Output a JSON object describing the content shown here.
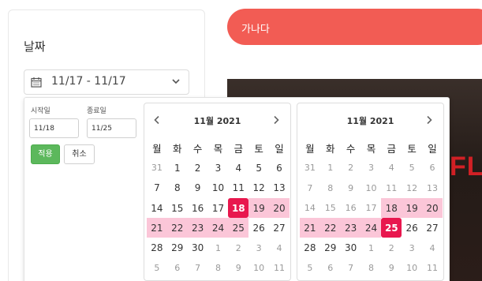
{
  "filter": {
    "title": "날짜",
    "range_text": "11/17 - 11/17"
  },
  "banner": {
    "text": "가나다",
    "color": "#f25c54"
  },
  "background": {
    "brand_text": "FLIX"
  },
  "picker": {
    "start_label": "시작일",
    "end_label": "종료일",
    "start_value": "11/18",
    "end_value": "11/25",
    "apply_label": "적용",
    "cancel_label": "취소",
    "accent": "#e8174e",
    "range_color": "#fbc6d8",
    "calendars": [
      {
        "title": "11월 2021",
        "endpoint_day": "18",
        "weekdays": [
          "월",
          "화",
          "수",
          "목",
          "금",
          "토",
          "일"
        ],
        "weeks": [
          [
            {
              "d": "31",
              "s": "off"
            },
            {
              "d": "1",
              "s": ""
            },
            {
              "d": "2",
              "s": ""
            },
            {
              "d": "3",
              "s": ""
            },
            {
              "d": "4",
              "s": ""
            },
            {
              "d": "5",
              "s": ""
            },
            {
              "d": "6",
              "s": ""
            }
          ],
          [
            {
              "d": "7",
              "s": ""
            },
            {
              "d": "8",
              "s": ""
            },
            {
              "d": "9",
              "s": ""
            },
            {
              "d": "10",
              "s": ""
            },
            {
              "d": "11",
              "s": ""
            },
            {
              "d": "12",
              "s": ""
            },
            {
              "d": "13",
              "s": ""
            }
          ],
          [
            {
              "d": "14",
              "s": ""
            },
            {
              "d": "15",
              "s": ""
            },
            {
              "d": "16",
              "s": ""
            },
            {
              "d": "17",
              "s": ""
            },
            {
              "d": "18",
              "s": "end"
            },
            {
              "d": "19",
              "s": "range"
            },
            {
              "d": "20",
              "s": "range"
            }
          ],
          [
            {
              "d": "21",
              "s": "range"
            },
            {
              "d": "22",
              "s": "range"
            },
            {
              "d": "23",
              "s": "range"
            },
            {
              "d": "24",
              "s": "range"
            },
            {
              "d": "25",
              "s": "range"
            },
            {
              "d": "26",
              "s": ""
            },
            {
              "d": "27",
              "s": ""
            }
          ],
          [
            {
              "d": "28",
              "s": ""
            },
            {
              "d": "29",
              "s": ""
            },
            {
              "d": "30",
              "s": ""
            },
            {
              "d": "1",
              "s": "off"
            },
            {
              "d": "2",
              "s": "off"
            },
            {
              "d": "3",
              "s": "off"
            },
            {
              "d": "4",
              "s": "off"
            }
          ],
          [
            {
              "d": "5",
              "s": "off"
            },
            {
              "d": "6",
              "s": "off"
            },
            {
              "d": "7",
              "s": "off"
            },
            {
              "d": "8",
              "s": "off"
            },
            {
              "d": "9",
              "s": "off"
            },
            {
              "d": "10",
              "s": "off"
            },
            {
              "d": "11",
              "s": "off"
            }
          ]
        ]
      },
      {
        "title": "11월 2021",
        "endpoint_day": "25",
        "weekdays": [
          "월",
          "화",
          "수",
          "목",
          "금",
          "토",
          "일"
        ],
        "weeks": [
          [
            {
              "d": "31",
              "s": "off"
            },
            {
              "d": "1",
              "s": "off"
            },
            {
              "d": "2",
              "s": "off"
            },
            {
              "d": "3",
              "s": "off"
            },
            {
              "d": "4",
              "s": "off"
            },
            {
              "d": "5",
              "s": "off"
            },
            {
              "d": "6",
              "s": "off"
            }
          ],
          [
            {
              "d": "7",
              "s": "off"
            },
            {
              "d": "8",
              "s": "off"
            },
            {
              "d": "9",
              "s": "off"
            },
            {
              "d": "10",
              "s": "off"
            },
            {
              "d": "11",
              "s": "off"
            },
            {
              "d": "12",
              "s": "off"
            },
            {
              "d": "13",
              "s": "off"
            }
          ],
          [
            {
              "d": "14",
              "s": "off"
            },
            {
              "d": "15",
              "s": "off"
            },
            {
              "d": "16",
              "s": "off"
            },
            {
              "d": "17",
              "s": "off"
            },
            {
              "d": "18",
              "s": "range"
            },
            {
              "d": "19",
              "s": "range"
            },
            {
              "d": "20",
              "s": "range"
            }
          ],
          [
            {
              "d": "21",
              "s": "range"
            },
            {
              "d": "22",
              "s": "range"
            },
            {
              "d": "23",
              "s": "range"
            },
            {
              "d": "24",
              "s": "range"
            },
            {
              "d": "25",
              "s": "end"
            },
            {
              "d": "26",
              "s": ""
            },
            {
              "d": "27",
              "s": ""
            }
          ],
          [
            {
              "d": "28",
              "s": ""
            },
            {
              "d": "29",
              "s": ""
            },
            {
              "d": "30",
              "s": ""
            },
            {
              "d": "1",
              "s": "off"
            },
            {
              "d": "2",
              "s": "off"
            },
            {
              "d": "3",
              "s": "off"
            },
            {
              "d": "4",
              "s": "off"
            }
          ],
          [
            {
              "d": "5",
              "s": "off"
            },
            {
              "d": "6",
              "s": "off"
            },
            {
              "d": "7",
              "s": "off"
            },
            {
              "d": "8",
              "s": "off"
            },
            {
              "d": "9",
              "s": "off"
            },
            {
              "d": "10",
              "s": "off"
            },
            {
              "d": "11",
              "s": "off"
            }
          ]
        ]
      }
    ]
  }
}
